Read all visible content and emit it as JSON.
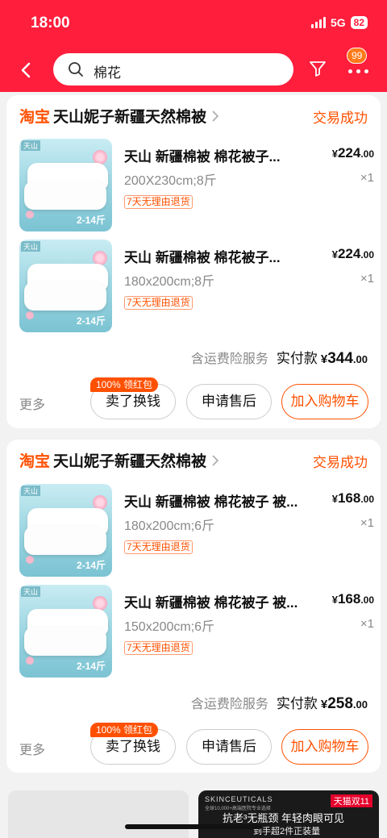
{
  "status_bar": {
    "time": "18:00",
    "network": "5G",
    "battery": "82"
  },
  "search": {
    "query": "棉花",
    "badge_count": "99"
  },
  "orders": [
    {
      "platform": "淘宝",
      "shop": "天山妮子新疆天然棉被",
      "status": "交易成功",
      "items": [
        {
          "title": "天山 新疆棉被  棉花被子...",
          "spec": "200X230cm;8斤",
          "tag": "7天无理由退货",
          "price_cur": "¥",
          "price_int": "224",
          "price_dec": ".00",
          "qty": "×1",
          "thumb_brand": "天山",
          "thumb_size": "2-14斤"
        },
        {
          "title": "天山 新疆棉被  棉花被子...",
          "spec": "180x200cm;8斤",
          "tag": "7天无理由退货",
          "price_cur": "¥",
          "price_int": "224",
          "price_dec": ".00",
          "qty": "×1",
          "thumb_brand": "天山",
          "thumb_size": "2-14斤"
        }
      ],
      "fee_label": "含运费险服务",
      "pay_label": "实付款",
      "pay_cur": "¥",
      "pay_int": "344",
      "pay_dec": ".00",
      "more": "更多",
      "red_packet": "100% 领红包",
      "btn_sell": "卖了换钱",
      "btn_after": "申请售后",
      "btn_cart": "加入购物车"
    },
    {
      "platform": "淘宝",
      "shop": "天山妮子新疆天然棉被",
      "status": "交易成功",
      "items": [
        {
          "title": "天山 新疆棉被  棉花被子 被...",
          "spec": "180x200cm;6斤",
          "tag": "7天无理由退货",
          "price_cur": "¥",
          "price_int": "168",
          "price_dec": ".00",
          "qty": "×1",
          "thumb_brand": "天山",
          "thumb_size": "2-14斤"
        },
        {
          "title": "天山 新疆棉被  棉花被子 被...",
          "spec": "150x200cm;6斤",
          "tag": "7天无理由退货",
          "price_cur": "¥",
          "price_int": "168",
          "price_dec": ".00",
          "qty": "×1",
          "thumb_brand": "天山",
          "thumb_size": "2-14斤"
        }
      ],
      "fee_label": "含运费险服务",
      "pay_label": "实付款",
      "pay_cur": "¥",
      "pay_int": "258",
      "pay_dec": ".00",
      "more": "更多",
      "red_packet": "100% 领红包",
      "btn_sell": "卖了换钱",
      "btn_after": "申请售后",
      "btn_cart": "加入购物车"
    }
  ],
  "ad": {
    "brand": "SKINCEUTICALS",
    "brand_sub": "全球10,000+高端医院专业选择",
    "tmall": "天猫双11",
    "line1": "抗老³无瓶颈 年轻肉眼可见",
    "line2": "到手超2件正装量"
  },
  "colors": {
    "header_red": "#ff1e3c",
    "accent_orange": "#ff5000"
  }
}
